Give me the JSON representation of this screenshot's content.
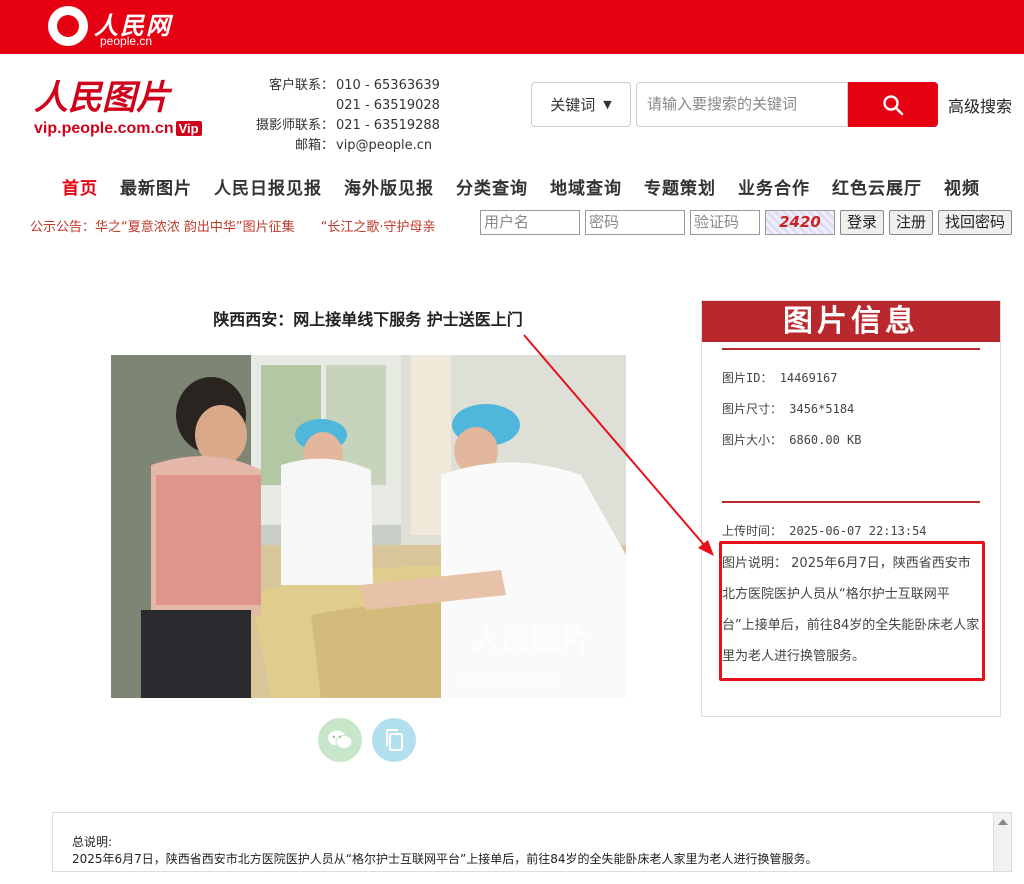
{
  "topbar": {
    "logo_text": "人民网",
    "logo_sub": "people.cn"
  },
  "brand": {
    "mark": "人民图片",
    "url": "vip.people.com.cn",
    "vip": "Vip"
  },
  "contact": [
    {
      "label": "客户联系：",
      "value": "010 - 65363639"
    },
    {
      "label": "",
      "value": "021 - 63519028"
    },
    {
      "label": "摄影师联系：",
      "value": "021 - 63519288"
    },
    {
      "label": "邮箱：",
      "value": "vip@people.cn"
    }
  ],
  "search": {
    "keyword_select": "关键词",
    "placeholder": "请输入要搜索的关键词",
    "advanced": "高级搜索"
  },
  "nav": [
    "首页",
    "最新图片",
    "人民日报见报",
    "海外版见报",
    "分类查询",
    "地域查询",
    "专题策划",
    "业务合作",
    "红色云展厅",
    "视频"
  ],
  "notice": {
    "label": "公示公告：",
    "text": "华之“夏意浓浓 韵出中华”图片征集　　“长江之歌·守护母亲"
  },
  "login": {
    "username": "用户名",
    "password": "密码",
    "captcha": "验证码",
    "captcha_img": "2420",
    "login_btn": "登录",
    "register_btn": "注册",
    "recover_btn": "找回密码"
  },
  "article": {
    "title": "陕西西安：网上接单线下服务 护士送医上门",
    "watermark": "人民图片",
    "watermark_url": "vip.people.com.cn"
  },
  "info": {
    "header": "图片信息",
    "id_label": "图片ID：",
    "id": "14469167",
    "size_label": "图片尺寸：",
    "size": "3456*5184",
    "filesize_label": "图片大小：",
    "filesize": "6860.00 KB",
    "upload_label": "上传时间：",
    "upload": "2025-06-07 22:13:54",
    "desc_label": "图片说明：",
    "desc": "2025年6月7日，陕西省西安市北方医院医护人员从“格尔护士互联网平台”上接单后，前往84岁的全失能卧床老人家里为老人进行换管服务。"
  },
  "summary": {
    "label": "总说明:",
    "text": "2025年6月7日，陕西省西安市北方医院医护人员从“格尔护士互联网平台”上接单后，前往84岁的全失能卧床老人家里为老人进行换管服务。"
  },
  "colors": {
    "brand_red": "#e50012",
    "info_red": "#b8282d",
    "highlight": "#e8111b"
  },
  "icons": {
    "search": "search-icon",
    "wechat": "wechat-icon",
    "copy": "copy-icon"
  }
}
